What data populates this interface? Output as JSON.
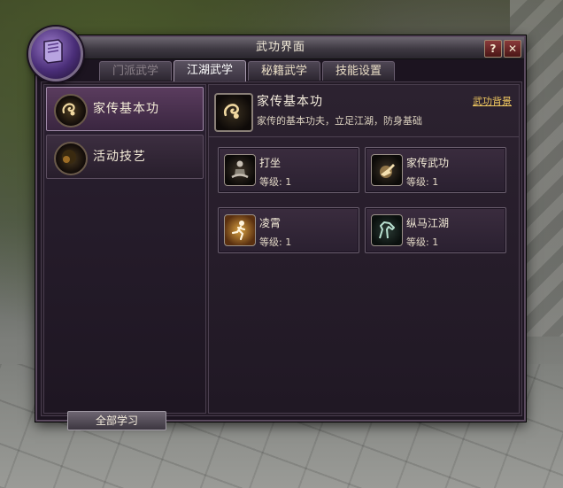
{
  "window": {
    "title": "武功界面",
    "help_label": "?",
    "close_label": "✕"
  },
  "tabs": [
    {
      "label": "门派武学",
      "state": "disabled"
    },
    {
      "label": "江湖武学",
      "state": "active"
    },
    {
      "label": "秘籍武学",
      "state": "normal"
    },
    {
      "label": "技能设置",
      "state": "normal"
    }
  ],
  "sidebar": {
    "items": [
      {
        "label": "家传基本功",
        "icon": "swirl-fist-icon",
        "selected": true
      },
      {
        "label": "活动技艺",
        "icon": "dark-orb-icon",
        "selected": false
      }
    ]
  },
  "detail": {
    "title": "家传基本功",
    "description": "家传的基本功夫，立足江湖，防身基础",
    "background_link": "武功背景",
    "icon": "swirl-fist-icon"
  },
  "skills": [
    {
      "name": "打坐",
      "level": "等级: 1",
      "icon": "meditate-icon"
    },
    {
      "name": "家传武功",
      "level": "等级: 1",
      "icon": "palm-strike-icon"
    },
    {
      "name": "凌霄",
      "level": "等级: 1",
      "icon": "running-man-icon"
    },
    {
      "name": "纵马江湖",
      "level": "等级: 1",
      "icon": "horse-icon"
    }
  ],
  "footer": {
    "learn_all_label": "全部学习"
  },
  "colors": {
    "accent_gold": "#f0c860",
    "panel_bg": "#231a26",
    "tab_active_border": "#a89aae"
  }
}
